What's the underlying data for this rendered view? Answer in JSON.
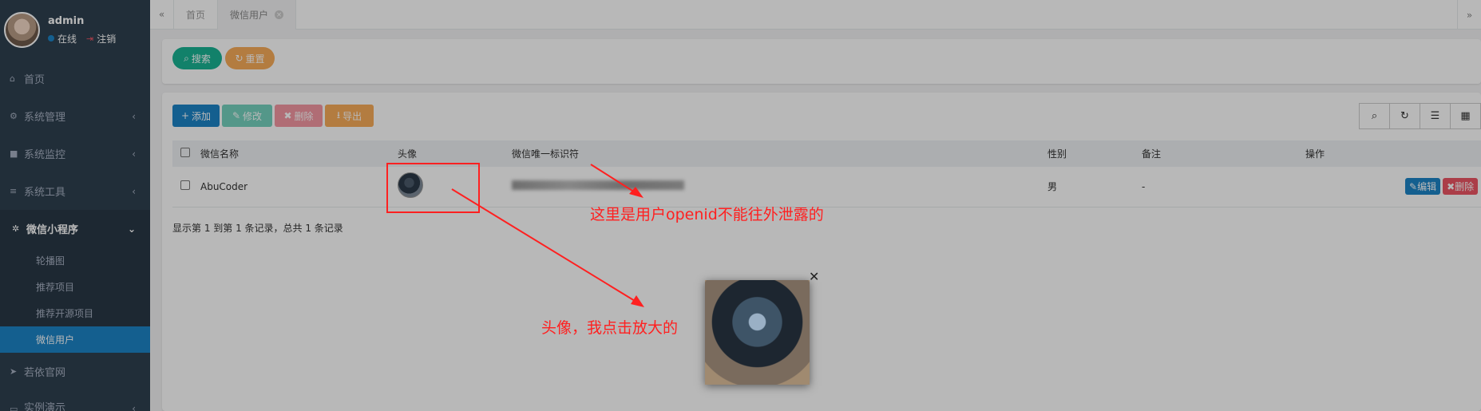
{
  "user": {
    "name": "admin",
    "status": "在线",
    "logout": "注销"
  },
  "sidebar": {
    "items": [
      {
        "label": "首页",
        "icon": "home-icon"
      },
      {
        "label": "系统管理",
        "icon": "gear-icon"
      },
      {
        "label": "系统监控",
        "icon": "video-icon"
      },
      {
        "label": "系统工具",
        "icon": "bars-icon"
      },
      {
        "label": "微信小程序",
        "icon": "cubes-icon"
      }
    ],
    "sub_items": [
      "轮播图",
      "推荐项目",
      "推荐开源项目",
      "微信用户"
    ],
    "extra": [
      {
        "label": "若依官网",
        "icon": "send-icon"
      },
      {
        "label": "实例演示",
        "icon": "desktop-icon"
      }
    ]
  },
  "tabs": [
    "首页",
    "微信用户"
  ],
  "search": {
    "search_label": "搜索",
    "reset_label": "重置"
  },
  "toolbar": {
    "add": "添加",
    "edit": "修改",
    "delete": "删除",
    "export": "导出"
  },
  "table": {
    "headers": [
      "微信名称",
      "头像",
      "微信唯一标识符",
      "性别",
      "备注",
      "操作"
    ],
    "rows": [
      {
        "name": "AbuCoder",
        "gender": "男",
        "remark": "-"
      }
    ],
    "row_actions": {
      "edit": "编辑",
      "delete": "删除"
    }
  },
  "pager_text": "显示第 1 到第 1 条记录，总共 1 条记录",
  "annotations": {
    "openid_note": "这里是用户openid不能往外泄露的",
    "avatar_note": "头像，我点击放大的"
  },
  "colors": {
    "primary": "#1c84c6",
    "success": "#1ab394",
    "warning": "#f8ac59",
    "danger": "#ed5565",
    "annotation": "#ff2020"
  }
}
